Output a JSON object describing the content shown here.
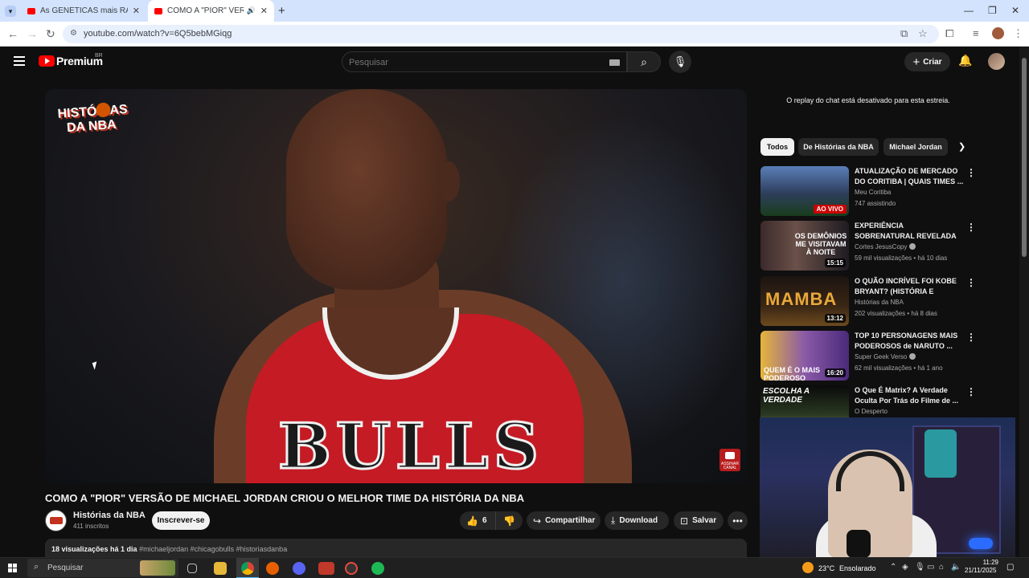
{
  "browser": {
    "tabs": [
      {
        "title": "As GENÉTICAS mais RARAS do ...",
        "active": false
      },
      {
        "title": "COMO A \"PIOR\" VERSÃO D",
        "active": true
      }
    ],
    "url": "youtube.com/watch?v=6Q5bebMGiqg"
  },
  "youtube": {
    "brand": "Premium",
    "region": "BR",
    "search_placeholder": "Pesquisar",
    "create_label": "Criar"
  },
  "video": {
    "channel_logo_text": "HISTÓRIAS DA NBA",
    "title": "COMO A \"PIOR\" VERSÃO DE MICHAEL JORDAN CRIOU O MELHOR TIME DA HISTÓRIA DA NBA",
    "channel": "Histórias da NBA",
    "subscribers": "411 inscritos",
    "subscribe_label": "Inscrever-se",
    "likes": "6",
    "share_label": "Compartilhar",
    "download_label": "Download",
    "save_label": "Salvar",
    "views": "18 visualizações  há 1 dia",
    "hashtags": "#michaeljordan #chicagobulls #historiasdanba",
    "watermark_label": "ASSINAR CANAL"
  },
  "sidebar": {
    "chat_replay": "O replay do chat está desativado para esta estreia.",
    "chips": [
      "Todos",
      "De Histórias da NBA",
      "Michael Jordan"
    ],
    "recommendations": [
      {
        "title": "ATUALIZAÇÃO DE MERCADO DO CORITIBA | QUAIS TIMES ...",
        "channel": "Meu Coritiba",
        "meta": "747 assistindo",
        "badge": "AO VIVO",
        "verified": false
      },
      {
        "title": "EXPERIÊNCIA SOBRENATURAL REVELADA POR ANA PAULA ...",
        "channel": "Cortes JesusCopy",
        "meta": "59 mil visualizações • há 10 dias",
        "duration": "15:15",
        "verified": true,
        "thumb_text": "OS DEMÔNIOS ME VISITAVAM À NOITE"
      },
      {
        "title": "O QUÃO INCRÍVEL FOI KOBE BRYANT? (HISTÓRIA E LEGAD...",
        "channel": "Histórias da NBA",
        "meta": "202 visualizações • há 8 dias",
        "duration": "13:12",
        "verified": false,
        "thumb_text": "MAMBA"
      },
      {
        "title": "TOP 10 PERSONAGENS MAIS PODEROSOS de NARUTO ...",
        "channel": "Super Geek Verso",
        "meta": "62 mil visualizações • há 1 ano",
        "duration": "16:20",
        "verified": true,
        "thumb_text": "QUEM É O MAIS PODEROSO"
      },
      {
        "title": "O Que É Matrix? A Verdade Oculta Por Trás do Filme de ...",
        "channel": "O Desperto",
        "meta": "",
        "verified": false,
        "thumb_text": "ESCOLHA A VERDADE"
      }
    ]
  },
  "taskbar": {
    "search_label": "Pesquisar",
    "temperature": "23°C",
    "weather": "Ensolarado",
    "time": "11:29",
    "date": "21/11/2025"
  }
}
